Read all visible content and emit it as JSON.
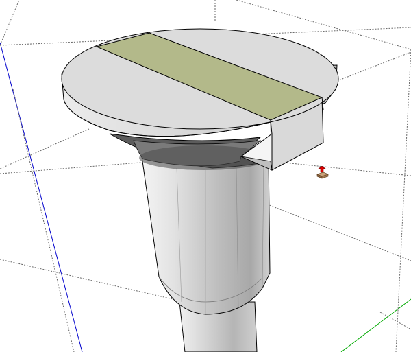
{
  "app": {
    "window_title": "",
    "tool": "push-pull",
    "cursor_icon": "push-pull-cursor-icon"
  },
  "scene": {
    "model": "screw",
    "slot_face_selected": true,
    "colors": {
      "background": "#ffffff",
      "face_light": "#dcdcdc",
      "face_mid": "#c8c8c8",
      "face_dark": "#8a8a8a",
      "edge": "#000000",
      "selected_face": "#b3b98a",
      "x_axis": "#00aa00",
      "y_axis": "#0000cc",
      "bounding_box": "#666666"
    }
  }
}
